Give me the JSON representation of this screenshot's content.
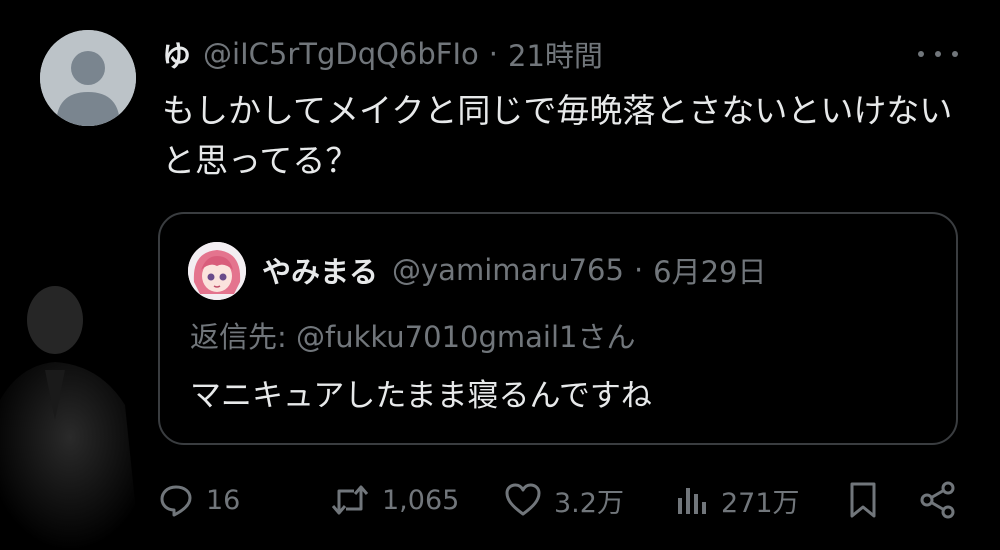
{
  "tweet": {
    "display_name": "ゆ",
    "handle": "@iIC5rTgDqQ6bFIo",
    "separator": "·",
    "time": "21時間",
    "text": "もしかしてメイクと同じで毎晩落とさないといけないと思ってる？",
    "avatar_icon": "default-user-avatar-icon",
    "more_icon": "more-dots-icon"
  },
  "quoted": {
    "display_name": "やみまる",
    "handle": "@yamimaru765",
    "separator": "·",
    "date": "6月29日",
    "reply_prefix": "返信先: ",
    "reply_mention": "@fukku7010gmail1さん",
    "text": "マニキュアしたまま寝るんですね",
    "avatar_icon": "anime-character-avatar-icon"
  },
  "actions": {
    "reply": {
      "icon": "reply-icon",
      "count": "16"
    },
    "retweet": {
      "icon": "retweet-icon",
      "count": "1,065"
    },
    "like": {
      "icon": "heart-icon",
      "count": "3.2万"
    },
    "views": {
      "icon": "views-chart-icon",
      "count": "271万"
    },
    "bookmark": {
      "icon": "bookmark-icon"
    },
    "share": {
      "icon": "share-icon"
    }
  },
  "colors": {
    "background": "#000000",
    "text_primary": "#e7e9ea",
    "text_secondary": "#71767b",
    "border": "#3a3d40"
  }
}
